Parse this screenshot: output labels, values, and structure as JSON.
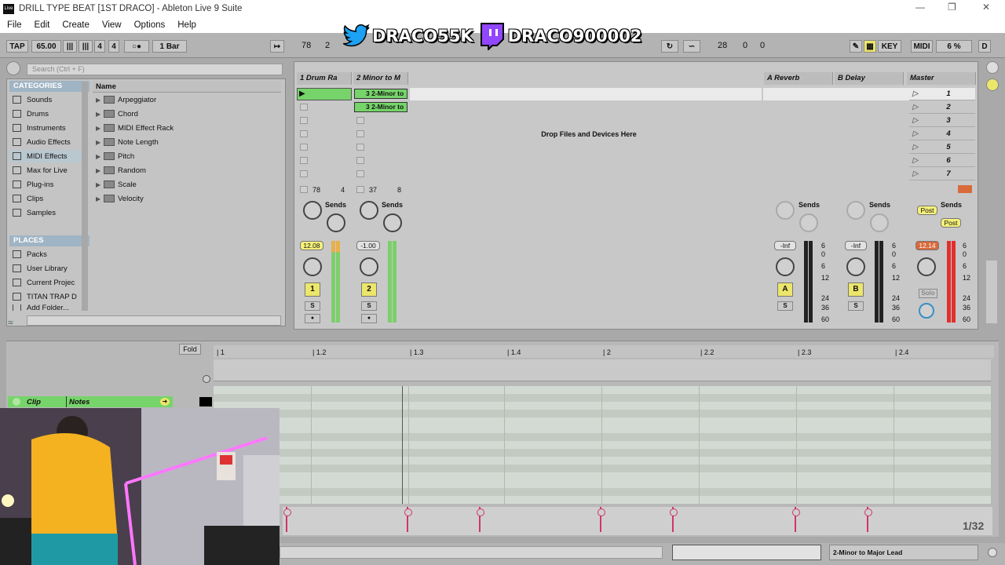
{
  "window": {
    "title": "DRILL TYPE BEAT [1ST DRACO] - Ableton Live 9 Suite",
    "logo": "Live"
  },
  "menu": [
    "File",
    "Edit",
    "Create",
    "View",
    "Options",
    "Help"
  ],
  "overlay": {
    "twitter_handle": "DRACO55K",
    "twitch_handle": "DRACO900002"
  },
  "transport": {
    "tap": "TAP",
    "tempo": "65.00",
    "time_sig_num": "4",
    "time_sig_den": "4",
    "quantize": "1 Bar",
    "arr_pos_bar": "78",
    "arr_pos_beat": "2",
    "loop_start": "28",
    "loop_beat": "0",
    "loop_sixteenth": "0",
    "key": "KEY",
    "midi": "MIDI",
    "cpu": "6 %",
    "d": "D"
  },
  "browser": {
    "search_placeholder": "Search (Ctrl + F)",
    "categories_title": "CATEGORIES",
    "categories": [
      "Sounds",
      "Drums",
      "Instruments",
      "Audio Effects",
      "MIDI Effects",
      "Max for Live",
      "Plug-ins",
      "Clips",
      "Samples"
    ],
    "places_title": "PLACES",
    "places": [
      "Packs",
      "User Library",
      "Current Projec",
      "TITAN TRAP D",
      "Add Folder..."
    ],
    "name_header": "Name",
    "items": [
      "Arpeggiator",
      "Chord",
      "MIDI Effect Rack",
      "Note Length",
      "Pitch",
      "Random",
      "Scale",
      "Velocity"
    ]
  },
  "session": {
    "tracks": [
      {
        "name": "1 Drum Ra",
        "num": "1",
        "vol": "12.08",
        "io_a": "78",
        "io_b": "4"
      },
      {
        "name": "2 Minor to M",
        "num": "2",
        "vol": "-1.00",
        "io_a": "37",
        "io_b": "8"
      }
    ],
    "clips": [
      "3 2-Minor to",
      "3 2-Minor to"
    ],
    "drop_text": "Drop Files and Devices Here",
    "returns": [
      {
        "name": "A Reverb",
        "btn": "A",
        "vol": "-Inf"
      },
      {
        "name": "B Delay",
        "btn": "B",
        "vol": "-Inf"
      }
    ],
    "master": {
      "name": "Master",
      "vol": "12.14",
      "post": "Post",
      "post2": "Post",
      "solo": "Solo"
    },
    "scenes": [
      "1",
      "2",
      "3",
      "4",
      "5",
      "6",
      "7"
    ],
    "sends": "Sends",
    "send_a": "A",
    "send_b": "B",
    "solo": "S",
    "db_scale": [
      "6",
      "0",
      "6",
      "12",
      "24",
      "36",
      "60"
    ]
  },
  "detail": {
    "fold": "Fold",
    "clip_tab": "Clip",
    "notes_tab": "Notes",
    "ruler": [
      "1",
      "1.2",
      "1.3",
      "1.4",
      "2",
      "2.2",
      "2.3",
      "2.4"
    ],
    "grid": "1/32"
  },
  "status": {
    "device": "2-Minor to Major Lead"
  },
  "colors": {
    "clip_green": "#76d46a",
    "knob_yellow": "#ece66a",
    "velocity_pink": "#d0356b",
    "category_blue": "#9fb4c4"
  }
}
